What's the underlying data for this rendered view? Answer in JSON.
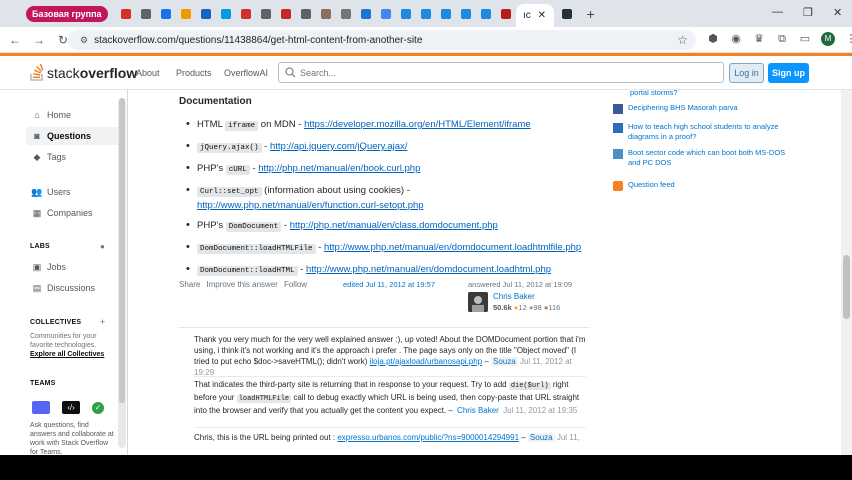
{
  "browser": {
    "tab_group_label": "Базовая группа",
    "active_tab_icon_text": "ıc",
    "url": "stackoverflow.com/questions/11438864/get-html-content-from-another-site",
    "profile_initial": "M"
  },
  "header": {
    "logo_light": "stack",
    "logo_bold": "overflow",
    "nav": [
      "About",
      "Products",
      "OverflowAI"
    ],
    "search_placeholder": "Search...",
    "login_label": "Log in",
    "signup_label": "Sign up"
  },
  "sidebar": {
    "items": [
      {
        "label": "Home",
        "icon": "home-icon"
      },
      {
        "label": "Questions",
        "icon": "questions-icon"
      },
      {
        "label": "Tags",
        "icon": "tag-icon"
      },
      {
        "label": "Users",
        "icon": "users-icon"
      },
      {
        "label": "Companies",
        "icon": "companies-icon"
      }
    ],
    "labs_label": "LABS",
    "labs_items": [
      {
        "label": "Jobs",
        "icon": "jobs-icon"
      },
      {
        "label": "Discussions",
        "icon": "discussions-icon"
      }
    ],
    "collectives_label": "COLLECTIVES",
    "collectives_text": "Communities for your favorite technologies.",
    "explore_collectives": "Explore all Collectives",
    "teams_label": "TEAMS",
    "teams_text": "Ask questions, find answers and collaborate at work with Stack Overflow for Teams."
  },
  "answer": {
    "section_title": "Documentation",
    "items": [
      {
        "pre": "HTML ",
        "code": "iframe",
        "mid": " on MDN - ",
        "link": "https://developer.mozilla.org/en/HTML/Element/iframe",
        "link2": ""
      },
      {
        "pre": "",
        "code": "jQuery.ajax()",
        "mid": " - ",
        "link": "http://api.jquery.com/jQuery.ajax/",
        "link2": ""
      },
      {
        "pre": "PHP's ",
        "code": "cURL",
        "mid": " - ",
        "link": "http://php.net/manual/en/book.curl.php",
        "link2": ""
      },
      {
        "pre": "",
        "code": "Curl::set_opt",
        "mid": " (information about using cookies) -",
        "link": "",
        "link2": "http://www.php.net/manual/en/function.curl-setopt.php"
      },
      {
        "pre": "PHP's ",
        "code": "DomDocument",
        "mid": " - ",
        "link": "http://php.net/manual/en/class.domdocument.php",
        "link2": ""
      },
      {
        "pre": "",
        "code": "DomDocument::loadHTMLFile",
        "mid": " - ",
        "link": "http://www.php.net/manual/en/domdocument.loadhtmlfile.php",
        "link2": ""
      },
      {
        "pre": "",
        "code": "DomDocument::loadHTML",
        "mid": " - ",
        "link": "http://www.php.net/manual/en/domdocument.loadhtml.php",
        "link2": ""
      }
    ],
    "menu": [
      "Share",
      "Improve this answer",
      "Follow"
    ],
    "edited": "edited Jul 11, 2012 at 19:57",
    "answered": "answered Jul 11, 2012 at 19:09",
    "user": {
      "name": "Chris Baker",
      "rep": "50.6k",
      "gold": "12",
      "silver": "98",
      "bronze": "116"
    }
  },
  "comments": [
    {
      "text": "Thank you very much for the very well explained answer :), up voted! About the DOMDocument portion that i'm using, i think it's not working and it's the approach i prefer . The page says only on the title \"Object moved\" (I tried to put echo $doc->saveHTML(); didn't work) ",
      "link": "iloja.pt/ajaxload/urbanosapi.php",
      "author": "Souza",
      "date": "Jul 11, 2012 at 19:29"
    },
    {
      "t1": "That indicates the third-party site is returning that in response to your request. Try to add ",
      "c1": "die($url)",
      "t2": " right before your ",
      "c2": "loadHTMLFile",
      "t3": " call to debug exactly which URL is being used, then copy-paste that URL straight into the browser and verify that you actually get the content you expect. – ",
      "author": "Chris Baker",
      "date": "Jul 11, 2012 at 19:35"
    },
    {
      "text": "Chris, this is the URL being printed out : ",
      "link": "expresso.urbanos.com/public/?ns=9000014294991",
      "author": "Souza",
      "date": "Jul 11,"
    }
  ],
  "hot_questions": [
    {
      "title": "portal storms?",
      "icon": "stackexchange-icon"
    },
    {
      "title": "Deciphering BHS Masorah parva",
      "icon": "judaism-icon"
    },
    {
      "title": "How to teach high school students to analyze diagrams in a proof?",
      "icon": "matheducators-icon"
    },
    {
      "title": "Boot sector code which can boot both MS-DOS and PC DOS",
      "icon": "retrocomputing-icon"
    }
  ],
  "question_feed": "Question feed",
  "colors": {
    "accent": "#f48024",
    "link": "#0063bf",
    "primary_button": "#0a95ff"
  }
}
